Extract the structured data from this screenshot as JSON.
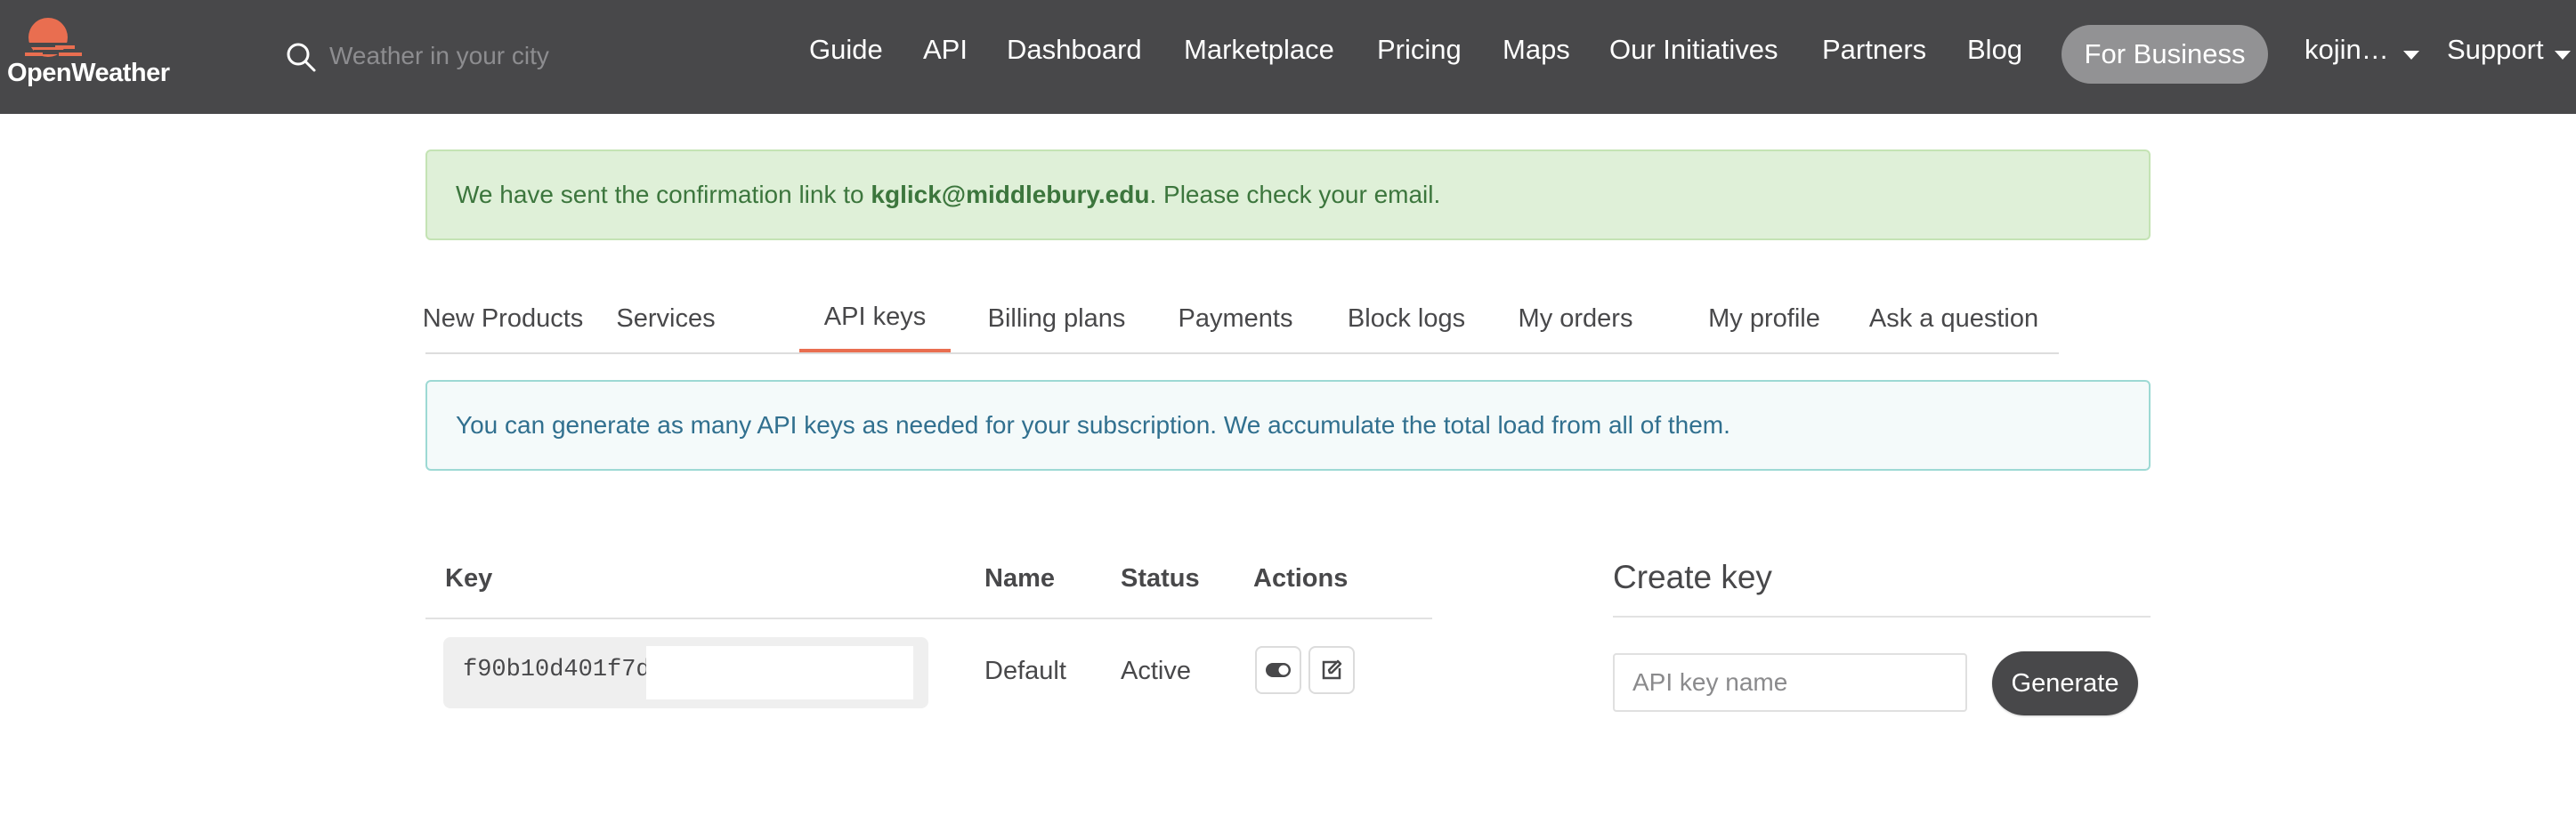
{
  "brand": {
    "name": "OpenWeather",
    "accent": "#e96e50",
    "navbar_bg": "#48484a"
  },
  "search": {
    "placeholder": "Weather in your city",
    "icon": "search-icon"
  },
  "nav": {
    "items": [
      "Guide",
      "API",
      "Dashboard",
      "Marketplace",
      "Pricing",
      "Maps",
      "Our Initiatives",
      "Partners",
      "Blog"
    ],
    "for_business": "For Business",
    "user": "kojin…",
    "support": "Support"
  },
  "alert_confirmation": {
    "prefix": "We have sent the confirmation link to ",
    "email": "kglick@middlebury.edu",
    "suffix": ". Please check your email."
  },
  "tabs": [
    {
      "label": "New Products",
      "active": false
    },
    {
      "label": "Services",
      "active": false
    },
    {
      "label": "API keys",
      "active": true
    },
    {
      "label": "Billing plans",
      "active": false
    },
    {
      "label": "Payments",
      "active": false
    },
    {
      "label": "Block logs",
      "active": false
    },
    {
      "label": "My orders",
      "active": false
    },
    {
      "label": "My profile",
      "active": false
    },
    {
      "label": "Ask a question",
      "active": false
    }
  ],
  "info_alert": "You can generate as many API keys as needed for your subscription. We accumulate the total load from all of them.",
  "keys_table": {
    "headers": {
      "key": "Key",
      "name": "Name",
      "status": "Status",
      "actions": "Actions"
    },
    "rows": [
      {
        "key": "f90b10d401f7d",
        "name": "Default",
        "status": "Active",
        "actions": [
          "toggle-icon",
          "edit-icon"
        ]
      }
    ]
  },
  "create_key": {
    "title": "Create key",
    "placeholder": "API key name",
    "button": "Generate"
  }
}
